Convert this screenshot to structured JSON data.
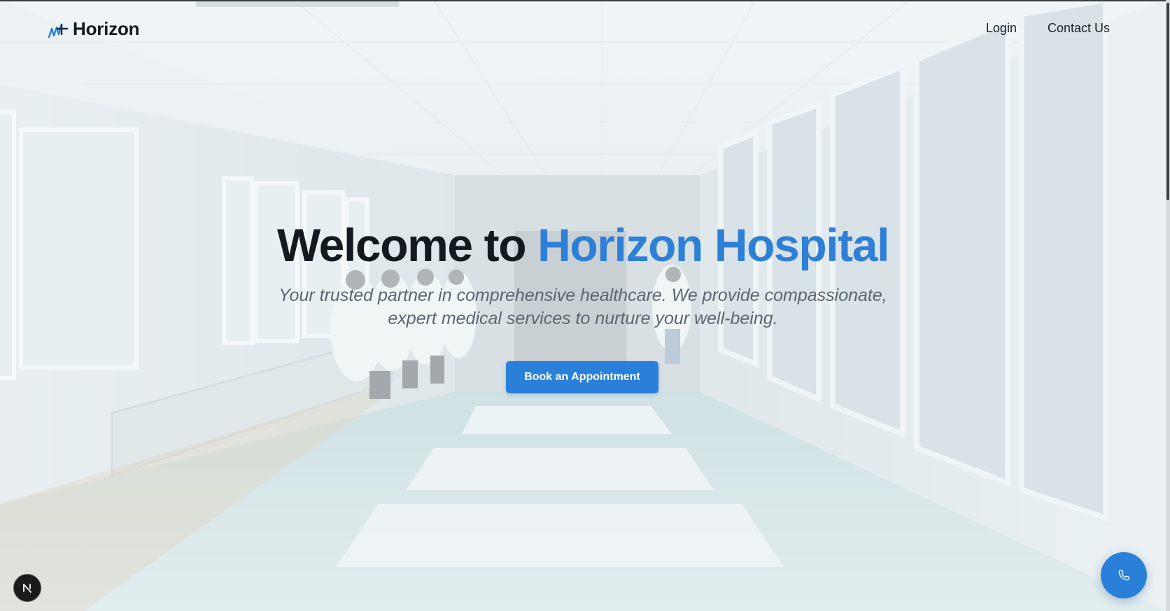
{
  "header": {
    "brand_name": "Horizon",
    "nav": [
      {
        "label": "Login"
      },
      {
        "label": "Contact Us"
      }
    ]
  },
  "hero": {
    "title_prefix": "Welcome to",
    "title_accent": "Horizon Hospital",
    "subtitle": "Your trusted partner in comprehensive healthcare. We provide compassionate, expert medical services to nurture your well-being.",
    "cta_label": "Book an Appointment",
    "background_image": "hospital-corridor-photo"
  },
  "floating": {
    "call_button_icon": "phone-icon",
    "dev_badge_icon": "next-logo-icon"
  },
  "colors": {
    "accent": "#2a7fd8",
    "title_accent": "#2e7fd6",
    "heading": "#14191f",
    "subtitle": "#5b6670"
  }
}
